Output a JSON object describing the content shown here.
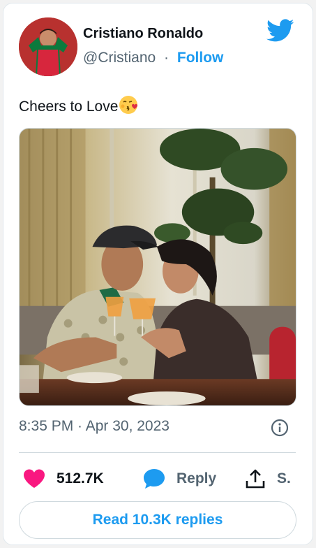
{
  "author": {
    "name": "Cristiano Ronaldo",
    "handle": "@Cristiano",
    "separator": "·",
    "follow_label": "Follow"
  },
  "tweet": {
    "text": "Cheers to Love",
    "emoji": "face-blowing-a-kiss",
    "timestamp": "8:35 PM · Apr 30, 2023"
  },
  "actions": {
    "like_count": "512.7K",
    "reply_label": "Reply",
    "share_label": "S."
  },
  "read_replies_label": "Read 10.3K replies",
  "colors": {
    "accent": "#1d9bf0",
    "like": "#f91880",
    "muted": "#536471",
    "text": "#0f1419"
  },
  "icons": [
    "twitter-bird-icon",
    "info-icon",
    "heart-icon",
    "reply-bubble-icon",
    "share-icon"
  ]
}
